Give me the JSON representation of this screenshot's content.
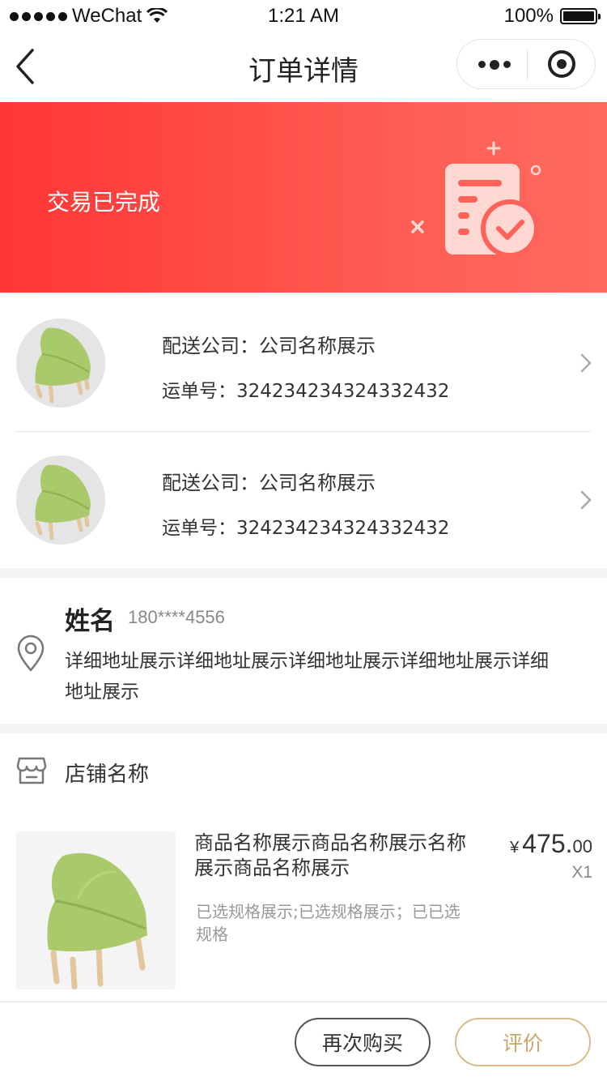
{
  "status_bar": {
    "carrier": "WeChat",
    "time": "1:21 AM",
    "battery": "100%"
  },
  "nav": {
    "title": "订单详情"
  },
  "banner": {
    "status_text": "交易已完成",
    "accent_from": "#ff3636",
    "accent_to": "#ff6a5e"
  },
  "logistics": {
    "items": [
      {
        "company_label": "配送公司：公司名称展示",
        "waybill_label": "运单号：324234234324332432"
      },
      {
        "company_label": "配送公司：公司名称展示",
        "waybill_label": "运单号：324234234324332432"
      }
    ]
  },
  "address": {
    "name": "姓名",
    "phone": "180****4556",
    "detail": "详细地址展示详细地址展示详细地址展示详细地址展示详细地址展示"
  },
  "store": {
    "name": "店铺名称",
    "product": {
      "name": "商品名称展示商品名称展示名称展示商品名称展示",
      "spec": "已选规格展示;已选规格展示；已已选规格",
      "currency": "¥",
      "price_int": "475.",
      "price_dec": "00",
      "quantity": "X1"
    }
  },
  "actions": {
    "rebuy_label": "再次购买",
    "review_label": "评价",
    "review_color": "#c8a56a"
  }
}
